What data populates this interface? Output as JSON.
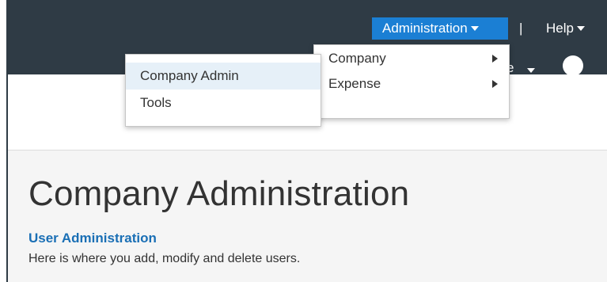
{
  "header": {
    "admin_label": "Administration",
    "separator": "|",
    "help_label": "Help",
    "profile_partial": "e"
  },
  "menus": {
    "main": [
      {
        "label": "Company"
      },
      {
        "label": "Expense"
      }
    ],
    "sub": [
      {
        "label": "Company Admin"
      },
      {
        "label": "Tools"
      }
    ]
  },
  "page": {
    "title": "Company Administration",
    "section_link": "User Administration",
    "section_desc": "Here is where you add, modify and delete users."
  },
  "colors": {
    "topbar": "#2f3b45",
    "accent": "#1b7fd4",
    "link": "#1a6fb5",
    "highlight": "#e6f0f8"
  }
}
